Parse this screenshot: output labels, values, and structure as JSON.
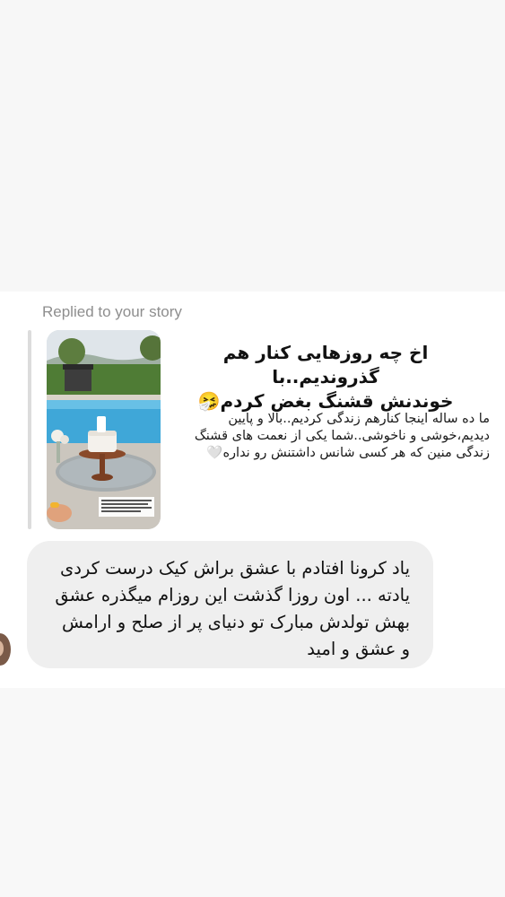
{
  "reply": {
    "label": "Replied to your story"
  },
  "story": {
    "title_lines": [
      "اخ چه روزهایی کنار هم گذروندیم..با",
      "خوندنش قشنگ بغض کردم🤧"
    ],
    "body_lines": [
      "ما ده ساله اینجا کنارهم زندگی کردیم..بالا و پایین",
      "دیدیم،خوشی و ناخوشی..شما یکی از نعمت های قشنگ",
      "زندگی منین که هر کسی شانس داشتنش رو نداره🤍"
    ]
  },
  "message": {
    "lines": [
      "یاد کرونا افتادم با عشق براش کیک درست کردی",
      "یادته ... اون روزا گذشت این روزام میگذره عشق",
      "بهش تولدش مبارک تو دنیای پر از صلح و ارامش",
      "و عشق و امید"
    ]
  },
  "colors": {
    "page_background": "#fbfbfb",
    "thread_background": "#ffffff",
    "bubble_background": "#efefef",
    "reply_label": "#8e8e8e",
    "quote_bar": "#dcdcdc"
  }
}
